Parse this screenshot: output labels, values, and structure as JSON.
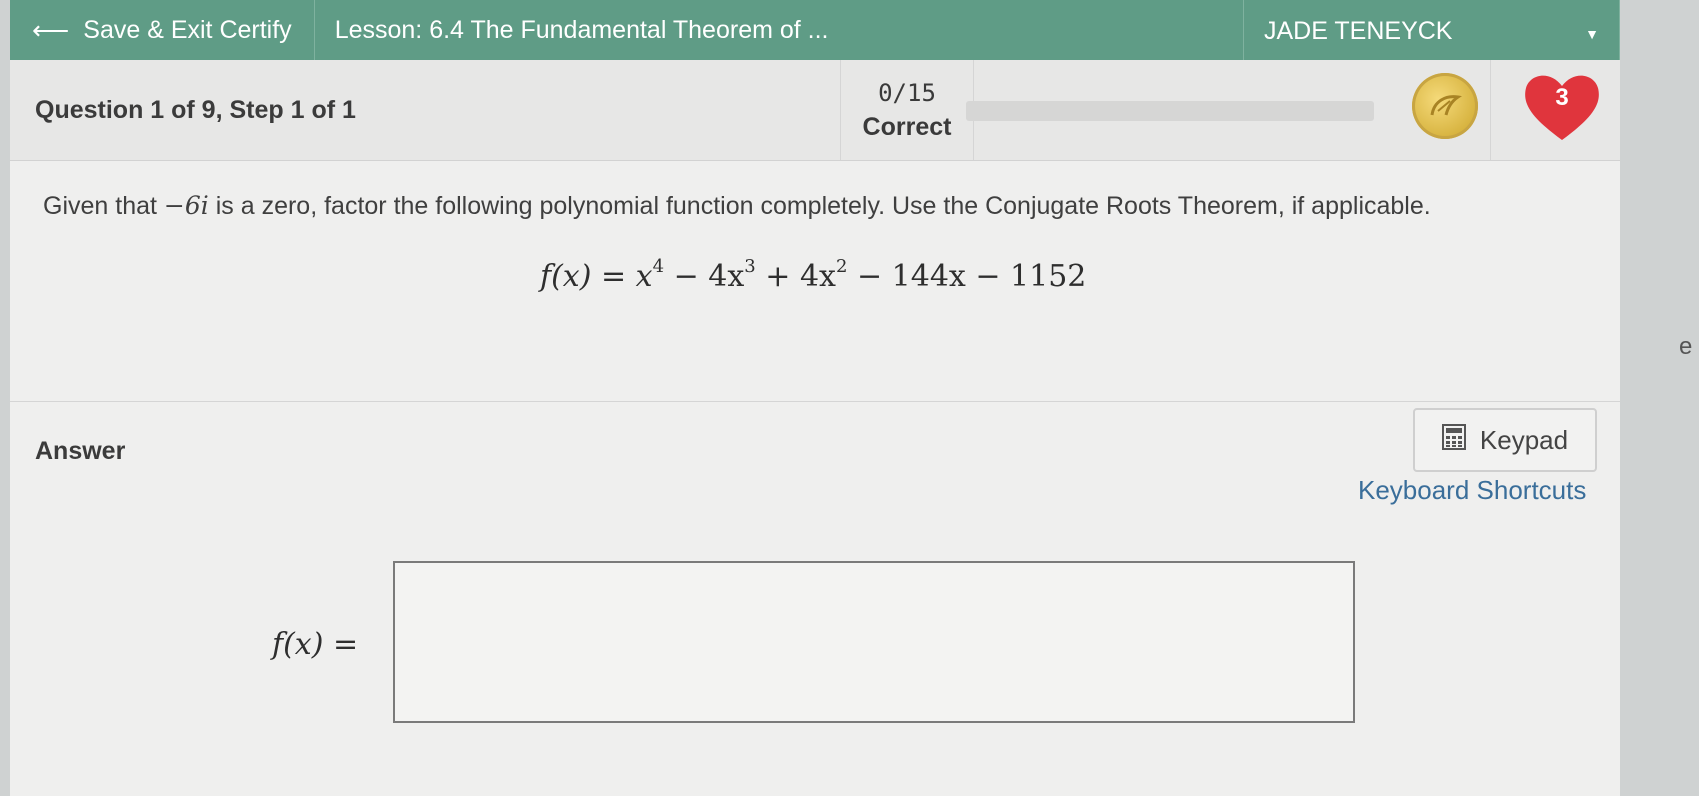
{
  "topbar": {
    "back_label": "Save & Exit Certify",
    "lesson_title": "Lesson: 6.4 The Fundamental Theorem of ...",
    "user_name": "JADE TENEYCK"
  },
  "question": {
    "title": "Question 1 of 9, Step 1 of 1",
    "score": "0/15",
    "score_label": "Correct",
    "hearts": "3",
    "prompt_before": "Given that",
    "prompt_zero": "−6i",
    "prompt_after": "is a zero, factor the following polynomial function completely. Use the Conjugate Roots Theorem, if applicable.",
    "equation_lhs": "f(x)",
    "equation_rhs_terms": [
      "x",
      "4",
      "− 4x",
      "3",
      "+ 4x",
      "2",
      "− 144x − 1152"
    ]
  },
  "answer": {
    "label": "Answer",
    "keypad_label": "Keypad",
    "shortcuts_label": "Keyboard Shortcuts",
    "fx_label": "f(x) =",
    "input_value": ""
  },
  "edge_text": "e",
  "colors": {
    "topbar": "#5f9c86",
    "heart": "#e0353d",
    "link": "#3a6e9a"
  }
}
